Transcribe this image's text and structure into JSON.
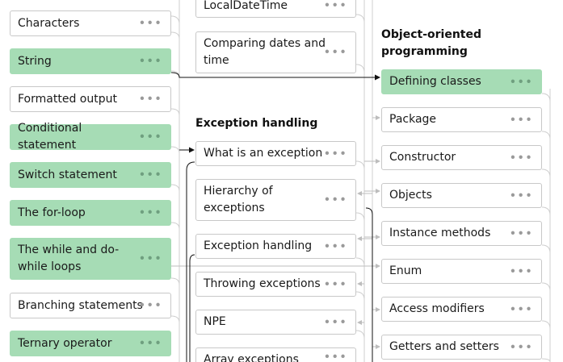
{
  "col1": {
    "items": [
      {
        "label": "Characters",
        "done": false
      },
      {
        "label": "String",
        "done": true
      },
      {
        "label": "Formatted output",
        "done": false
      },
      {
        "label": "Conditional statement",
        "done": true
      },
      {
        "label": "Switch statement",
        "done": true
      },
      {
        "label": "The for-loop",
        "done": true
      },
      {
        "label": "The while and do-while loops",
        "done": true
      },
      {
        "label": "Branching statements",
        "done": false
      },
      {
        "label": "Ternary operator",
        "done": true
      }
    ]
  },
  "col2": {
    "top_items": [
      {
        "label": "LocalDateTime",
        "done": false
      },
      {
        "label": "Comparing dates and time",
        "done": false
      }
    ],
    "heading": "Exception handling",
    "items": [
      {
        "label": "What is an exception",
        "done": false
      },
      {
        "label": "Hierarchy of exceptions",
        "done": false
      },
      {
        "label": "Exception handling",
        "done": false
      },
      {
        "label": "Throwing exceptions",
        "done": false
      },
      {
        "label": "NPE",
        "done": false
      },
      {
        "label": "Array exceptions",
        "done": false
      }
    ]
  },
  "col3": {
    "heading": "Object-oriented programming",
    "items": [
      {
        "label": "Defining classes",
        "done": true
      },
      {
        "label": "Package",
        "done": false
      },
      {
        "label": "Constructor",
        "done": false
      },
      {
        "label": "Objects",
        "done": false
      },
      {
        "label": "Instance methods",
        "done": false
      },
      {
        "label": "Enum",
        "done": false
      },
      {
        "label": "Access modifiers",
        "done": false
      },
      {
        "label": "Getters and setters",
        "done": false
      }
    ]
  },
  "more_icon": "more-dots-icon",
  "colors": {
    "done": "#a6dcb5",
    "border": "#c8c8c8",
    "connector": "#bdbdbd",
    "arrow": "#111111"
  }
}
